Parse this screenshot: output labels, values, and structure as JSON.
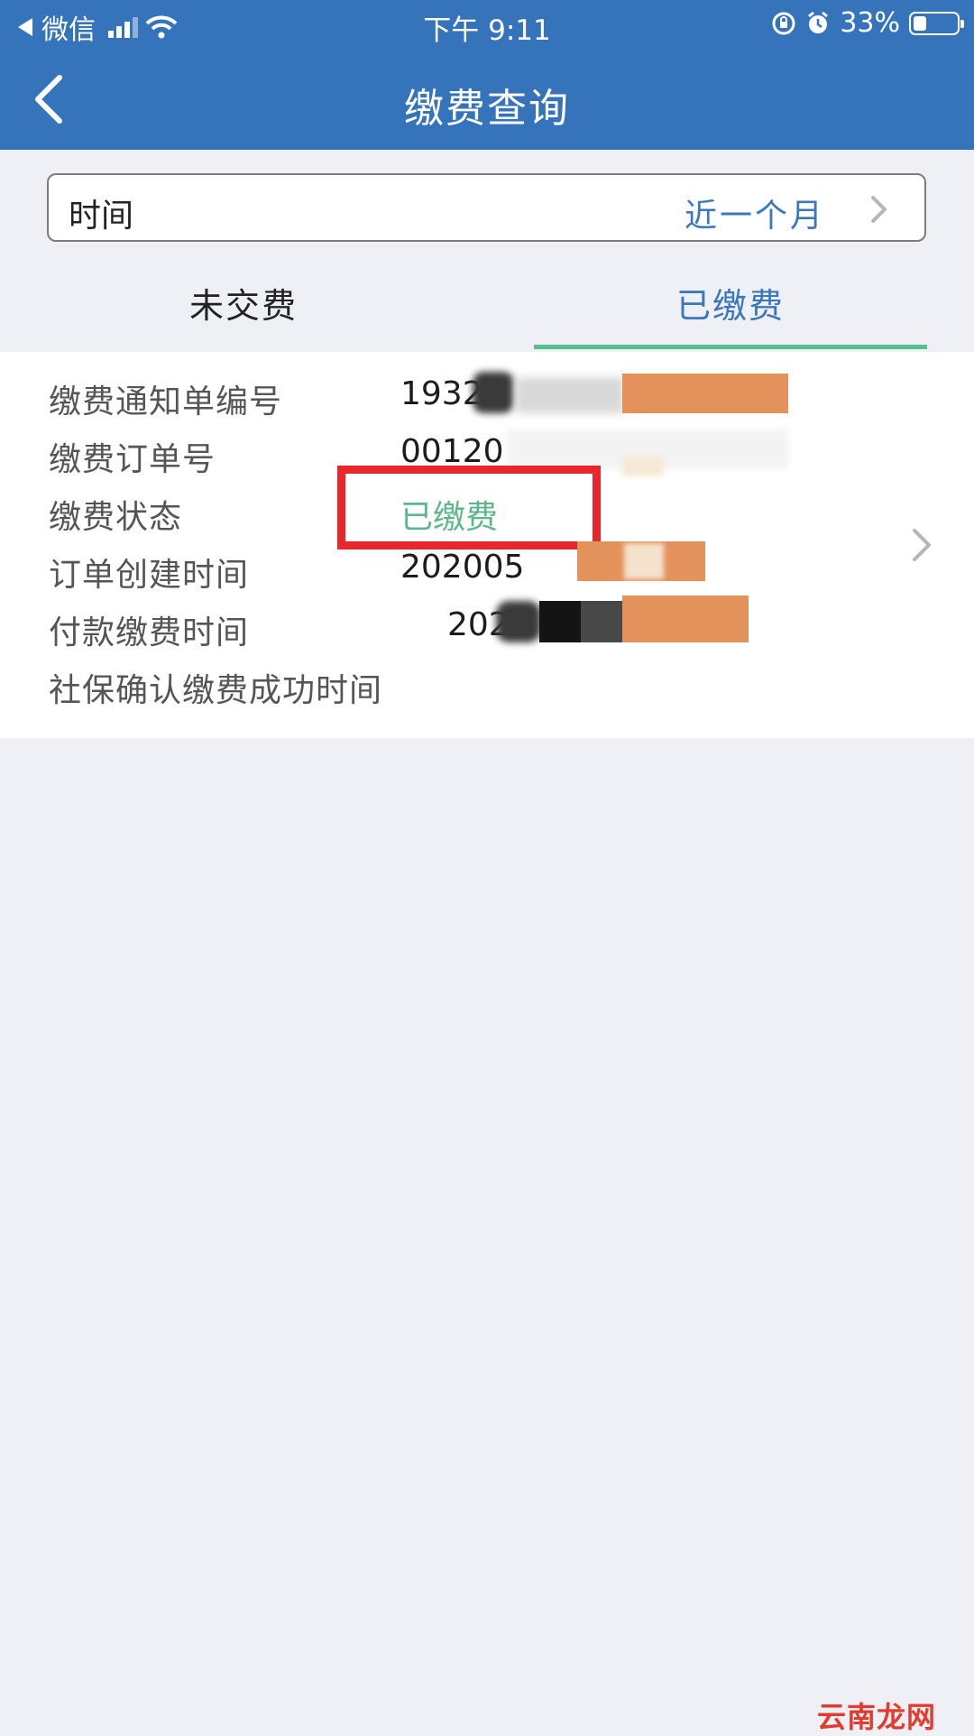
{
  "status_bar": {
    "back_app": "微信",
    "time": "下午 9:11",
    "battery_percent": "33%",
    "battery_level": 0.33,
    "icons": [
      "back-triangle-icon",
      "signal-icon",
      "wifi-icon",
      "rotation-lock-icon",
      "alarm-icon",
      "battery-icon"
    ]
  },
  "nav": {
    "title": "缴费查询",
    "back_icon": "chevron-left-icon"
  },
  "filter": {
    "label": "时间",
    "value": "近一个月",
    "icon": "chevron-right-icon"
  },
  "tabs": [
    {
      "label": "未交费",
      "active": false
    },
    {
      "label": "已缴费",
      "active": true
    }
  ],
  "record": {
    "fields": [
      {
        "label": "缴费通知单编号",
        "value": "1932"
      },
      {
        "label": "缴费订单号",
        "value": "00120"
      },
      {
        "label": "缴费状态",
        "value": "已缴费"
      },
      {
        "label": "订单创建时间",
        "value": "202005"
      },
      {
        "label": "付款缴费时间",
        "value": "202"
      },
      {
        "label": "社保确认缴费成功时间",
        "value": ""
      }
    ],
    "status_color": "#5cb88a",
    "highlight_color": "#e8262b"
  },
  "colors": {
    "header": "#3573ba",
    "accent": "#3a78be",
    "tab_indicator": "#57c08a",
    "background": "#eff0f5"
  },
  "watermark": "云南龙网"
}
